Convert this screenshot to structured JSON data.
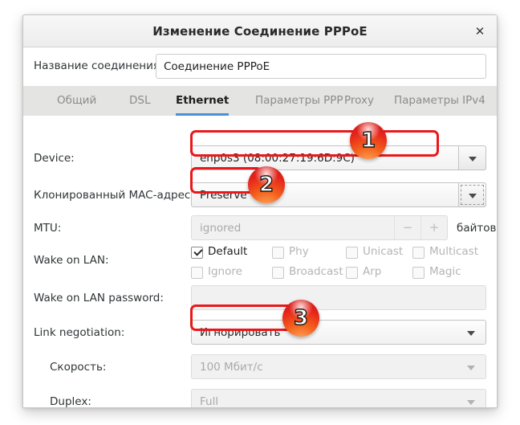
{
  "window": {
    "title": "Изменение Соединение PPPoE",
    "close_icon": "close-icon"
  },
  "connection_name": {
    "label": "Название соединения:",
    "value": "Соединение PPPoE",
    "placeholder": ""
  },
  "tabs": [
    {
      "label": "Общий",
      "active": false
    },
    {
      "label": "DSL",
      "active": false
    },
    {
      "label": "Ethernet",
      "active": true
    },
    {
      "label": "Параметры PPP",
      "active": false
    },
    {
      "label": "Proxy",
      "active": false
    },
    {
      "label": "Параметры IPv4",
      "active": false
    }
  ],
  "form": {
    "device": {
      "label": "Device:",
      "value": "enp0s3 (08:00:27:19:6D:9C)"
    },
    "cloned_mac": {
      "label": "Клонированный MAC-адрес:",
      "value": "Preserve"
    },
    "mtu": {
      "label": "MTU:",
      "placeholder": "ignored",
      "minus": "−",
      "plus": "+",
      "unit": "байтов"
    },
    "wake_on_lan": {
      "label": "Wake on LAN:",
      "options": [
        {
          "label": "Default",
          "checked": true,
          "enabled": true
        },
        {
          "label": "Phy",
          "checked": false,
          "enabled": false
        },
        {
          "label": "Unicast",
          "checked": false,
          "enabled": false
        },
        {
          "label": "Multicast",
          "checked": false,
          "enabled": false
        },
        {
          "label": "Ignore",
          "checked": false,
          "enabled": false
        },
        {
          "label": "Broadcast",
          "checked": false,
          "enabled": false
        },
        {
          "label": "Arp",
          "checked": false,
          "enabled": false
        },
        {
          "label": "Magic",
          "checked": false,
          "enabled": false
        }
      ]
    },
    "wol_password": {
      "label": "Wake on LAN password:",
      "value": ""
    },
    "link_negotiation": {
      "label": "Link negotiation:",
      "value": "Игнорировать"
    },
    "speed": {
      "label": "Скорость:",
      "value": "100 Мбит/с"
    },
    "duplex": {
      "label": "Duplex:",
      "value": "Full"
    }
  },
  "annotations": {
    "badges": [
      {
        "number": "1"
      },
      {
        "number": "2"
      },
      {
        "number": "3"
      }
    ],
    "highlight_color": "#e8181b",
    "badge_color": "#e5231b"
  }
}
